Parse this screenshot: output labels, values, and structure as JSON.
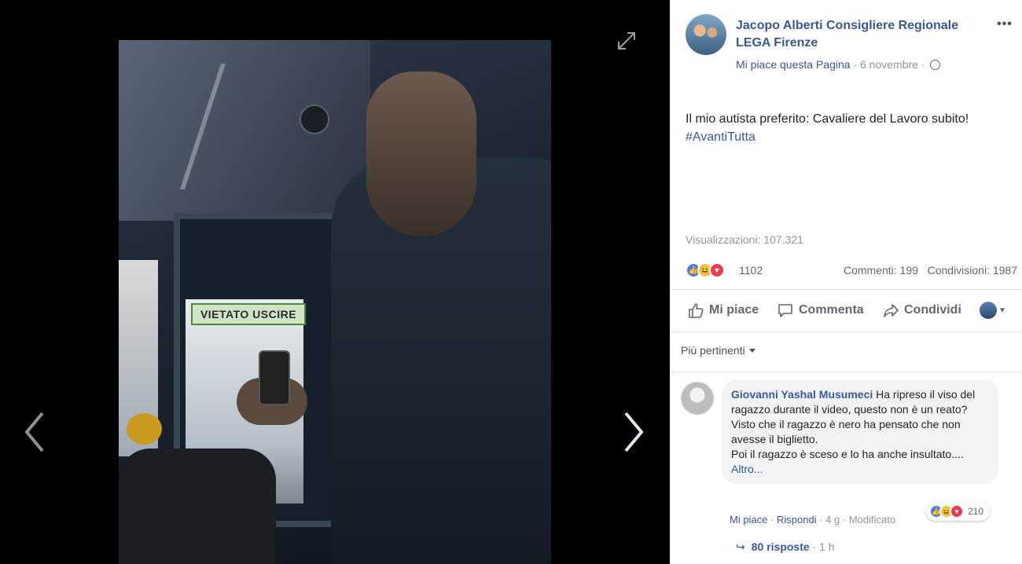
{
  "video": {
    "sign_text": "VIETATO USCIRE"
  },
  "post": {
    "page_name": "Jacopo Alberti Consigliere Regionale LEGA Firenze",
    "more": "•••",
    "like_page": "Mi piace questa Pagina",
    "date": "6 novembre",
    "text_line": "Il mio autista preferito: Cavaliere del Lavoro subito!",
    "hashtag": "#AvantiTutta",
    "views": "Visualizzazioni: 107.321",
    "reaction_count": "1102",
    "comments": "Commenti: 199",
    "shares": "Condivisioni: 1987"
  },
  "actions": {
    "like": "Mi piace",
    "comment": "Commenta",
    "share": "Condividi"
  },
  "sort_label": "Più pertinenti",
  "comment": {
    "author": "Giovanni Yashal Musumeci",
    "text": " Ha ripreso il viso del ragazzo durante il video, questo non è un reato?",
    "line2": "Visto che il ragazzo è nero ha pensato che non avesse il biglietto.",
    "line3": "Poi il ragazzo è sceso e lo ha anche insultato.... ",
    "more": "Altro...",
    "reaction_count": "210",
    "like": "Mi piace",
    "reply": "Rispondi",
    "time": "4 g",
    "edited": "Modificato",
    "replies": "80 risposte",
    "replies_time": "1 h"
  },
  "colors": {
    "link": "#365899",
    "muted": "#90949c",
    "like": "#4a7bf0",
    "love": "#f0374e",
    "haha": "#f7c23e"
  }
}
